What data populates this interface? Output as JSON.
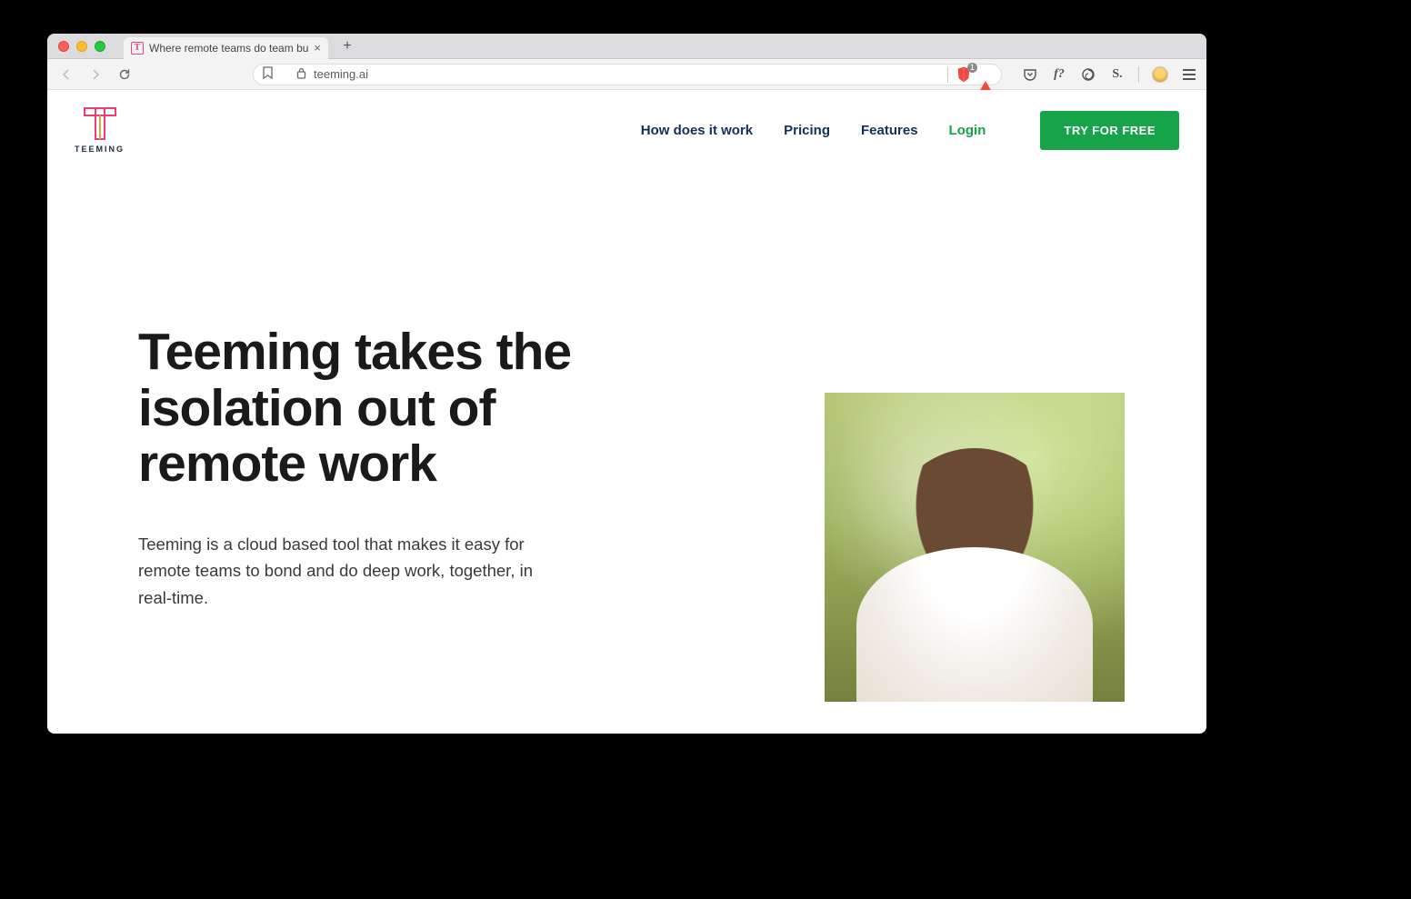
{
  "browser": {
    "tab_title": "Where remote teams do team bu",
    "url_display": "teeming.ai",
    "shield_count": "1"
  },
  "site": {
    "brand": "TEEMING",
    "nav": {
      "how": "How does it work",
      "pricing": "Pricing",
      "features": "Features",
      "login": "Login"
    },
    "cta": "TRY FOR FREE",
    "hero": {
      "title": "Teeming takes the isolation out of remote work",
      "subtitle": "Teeming is a cloud based tool that makes it easy for remote teams to bond and do deep work, together, in real-time."
    }
  }
}
